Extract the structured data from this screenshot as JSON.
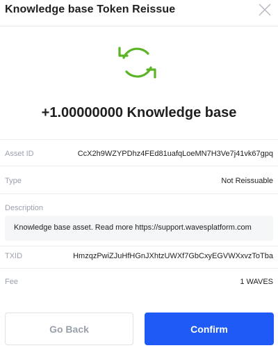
{
  "header": {
    "title": "Knowledge base Token Reissue"
  },
  "amount": "+1.00000000 Knowledge base",
  "colors": {
    "accent": "#1f5af6",
    "icon_green": "#5bb426"
  },
  "icons": {
    "top": "refresh-icon",
    "close": "close-icon"
  },
  "rows": {
    "asset_id": {
      "label": "Asset ID",
      "value": "CcX2h9WZYPDhz4FEd81uafqLoeMN7H3Ve7j41vk67gpq"
    },
    "type": {
      "label": "Type",
      "value": "Not Reissuable"
    },
    "description": {
      "label": "Description",
      "value": "Knowledge base asset. Read more https://support.wavesplatform.com"
    },
    "txid": {
      "label": "TXID",
      "value": "HmzqzPwiZJuHfHGnJXhtzUWXf7GbCxyEGVWXxvzToTba"
    },
    "fee": {
      "label": "Fee",
      "value": "1 WAVES"
    }
  },
  "buttons": {
    "back": "Go Back",
    "confirm": "Confirm"
  }
}
